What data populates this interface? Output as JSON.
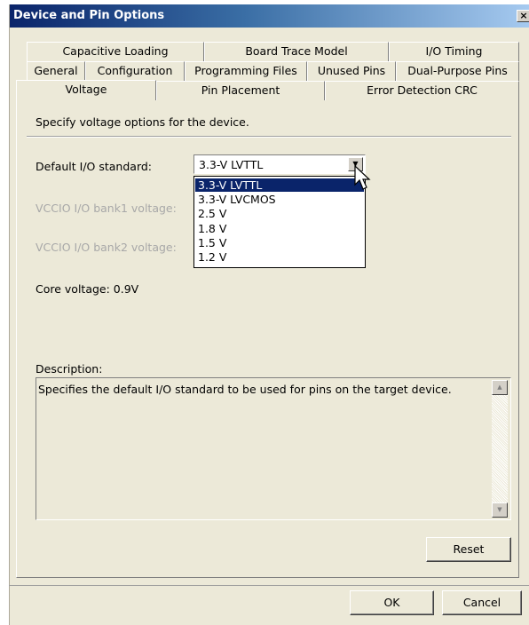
{
  "window": {
    "title": "Device and Pin Options",
    "close_label": "×"
  },
  "tabs": {
    "row1": [
      "Capacitive Loading",
      "Board Trace Model",
      "I/O Timing"
    ],
    "row2": [
      "General",
      "Configuration",
      "Programming Files",
      "Unused Pins",
      "Dual-Purpose Pins"
    ],
    "row3": [
      "Voltage",
      "Pin Placement",
      "Error Detection CRC"
    ],
    "active": "Voltage"
  },
  "voltage": {
    "heading": "Specify voltage options for the device.",
    "default_io_label": "Default I/O standard:",
    "default_io_value": "3.3-V LVTTL",
    "bank1_label": "VCCIO I/O bank1 voltage:",
    "bank2_label": "VCCIO I/O bank2 voltage:",
    "core_voltage": "Core voltage: 0.9V",
    "options": [
      "3.3-V LVTTL",
      "3.3-V LVCMOS",
      "2.5 V",
      "1.8 V",
      "1.5 V",
      "1.2 V"
    ],
    "selected_option": "3.3-V LVTTL"
  },
  "description": {
    "label": "Description:",
    "text": "Specifies the default I/O standard to be used for pins on the target device."
  },
  "buttons": {
    "reset": "Reset",
    "ok": "OK",
    "cancel": "Cancel"
  },
  "colors": {
    "selection": "#0a246a",
    "dialog_bg": "#ece9d8",
    "title_bar": "#0a246a"
  }
}
